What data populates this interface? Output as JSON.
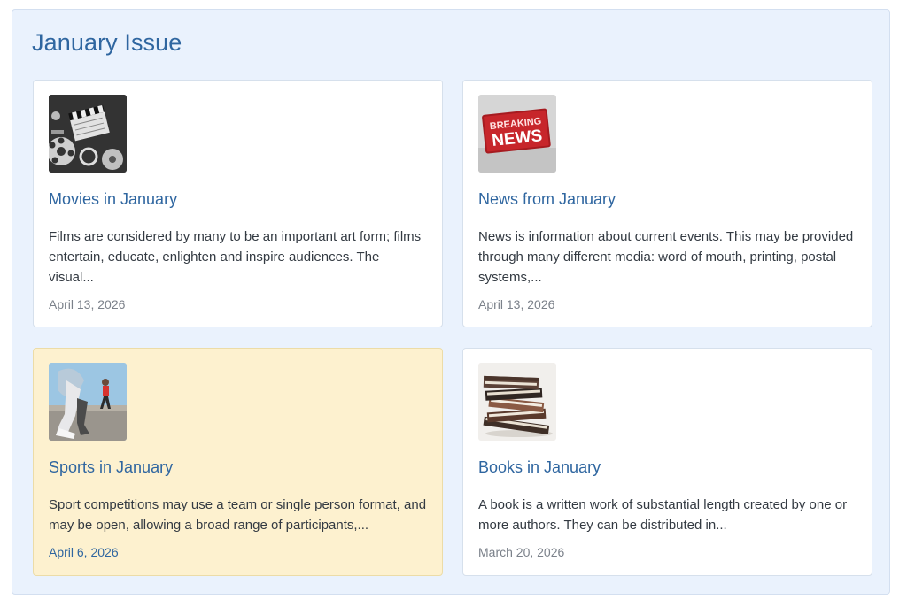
{
  "section": {
    "title": "January Issue"
  },
  "cards": [
    {
      "title": "Movies in January",
      "description": "Films are considered by many to be an important art form; films entertain, educate, enlighten and inspire audiences. The visual...",
      "date": "April 13, 2026",
      "image": "film-reels-clapperboard-photo"
    },
    {
      "title": "News from January",
      "description": "News is information about current events. This may be provided through many different media: word of mouth, printing, postal systems,...",
      "date": "April 13, 2026",
      "image": "breaking-news-sign-photo",
      "image_text": [
        "BREAKING",
        "NEWS"
      ]
    },
    {
      "title": "Sports in January",
      "description": "Sport competitions may use a team or single person format, and may be open, allowing a broad range of participants,...",
      "date": "April 6, 2026",
      "image": "runners-photo",
      "highlighted": true
    },
    {
      "title": "Books in January",
      "description": "A book is a written work of substantial length created by one or more authors. They can be distributed in...",
      "date": "March 20, 2026",
      "image": "stacked-books-photo"
    }
  ],
  "colors": {
    "panel_background": "#eaf2fd",
    "accent": "#2f66a0",
    "highlight_card": "#fdf1cf",
    "text": "#333a42",
    "muted": "#7b818a"
  }
}
